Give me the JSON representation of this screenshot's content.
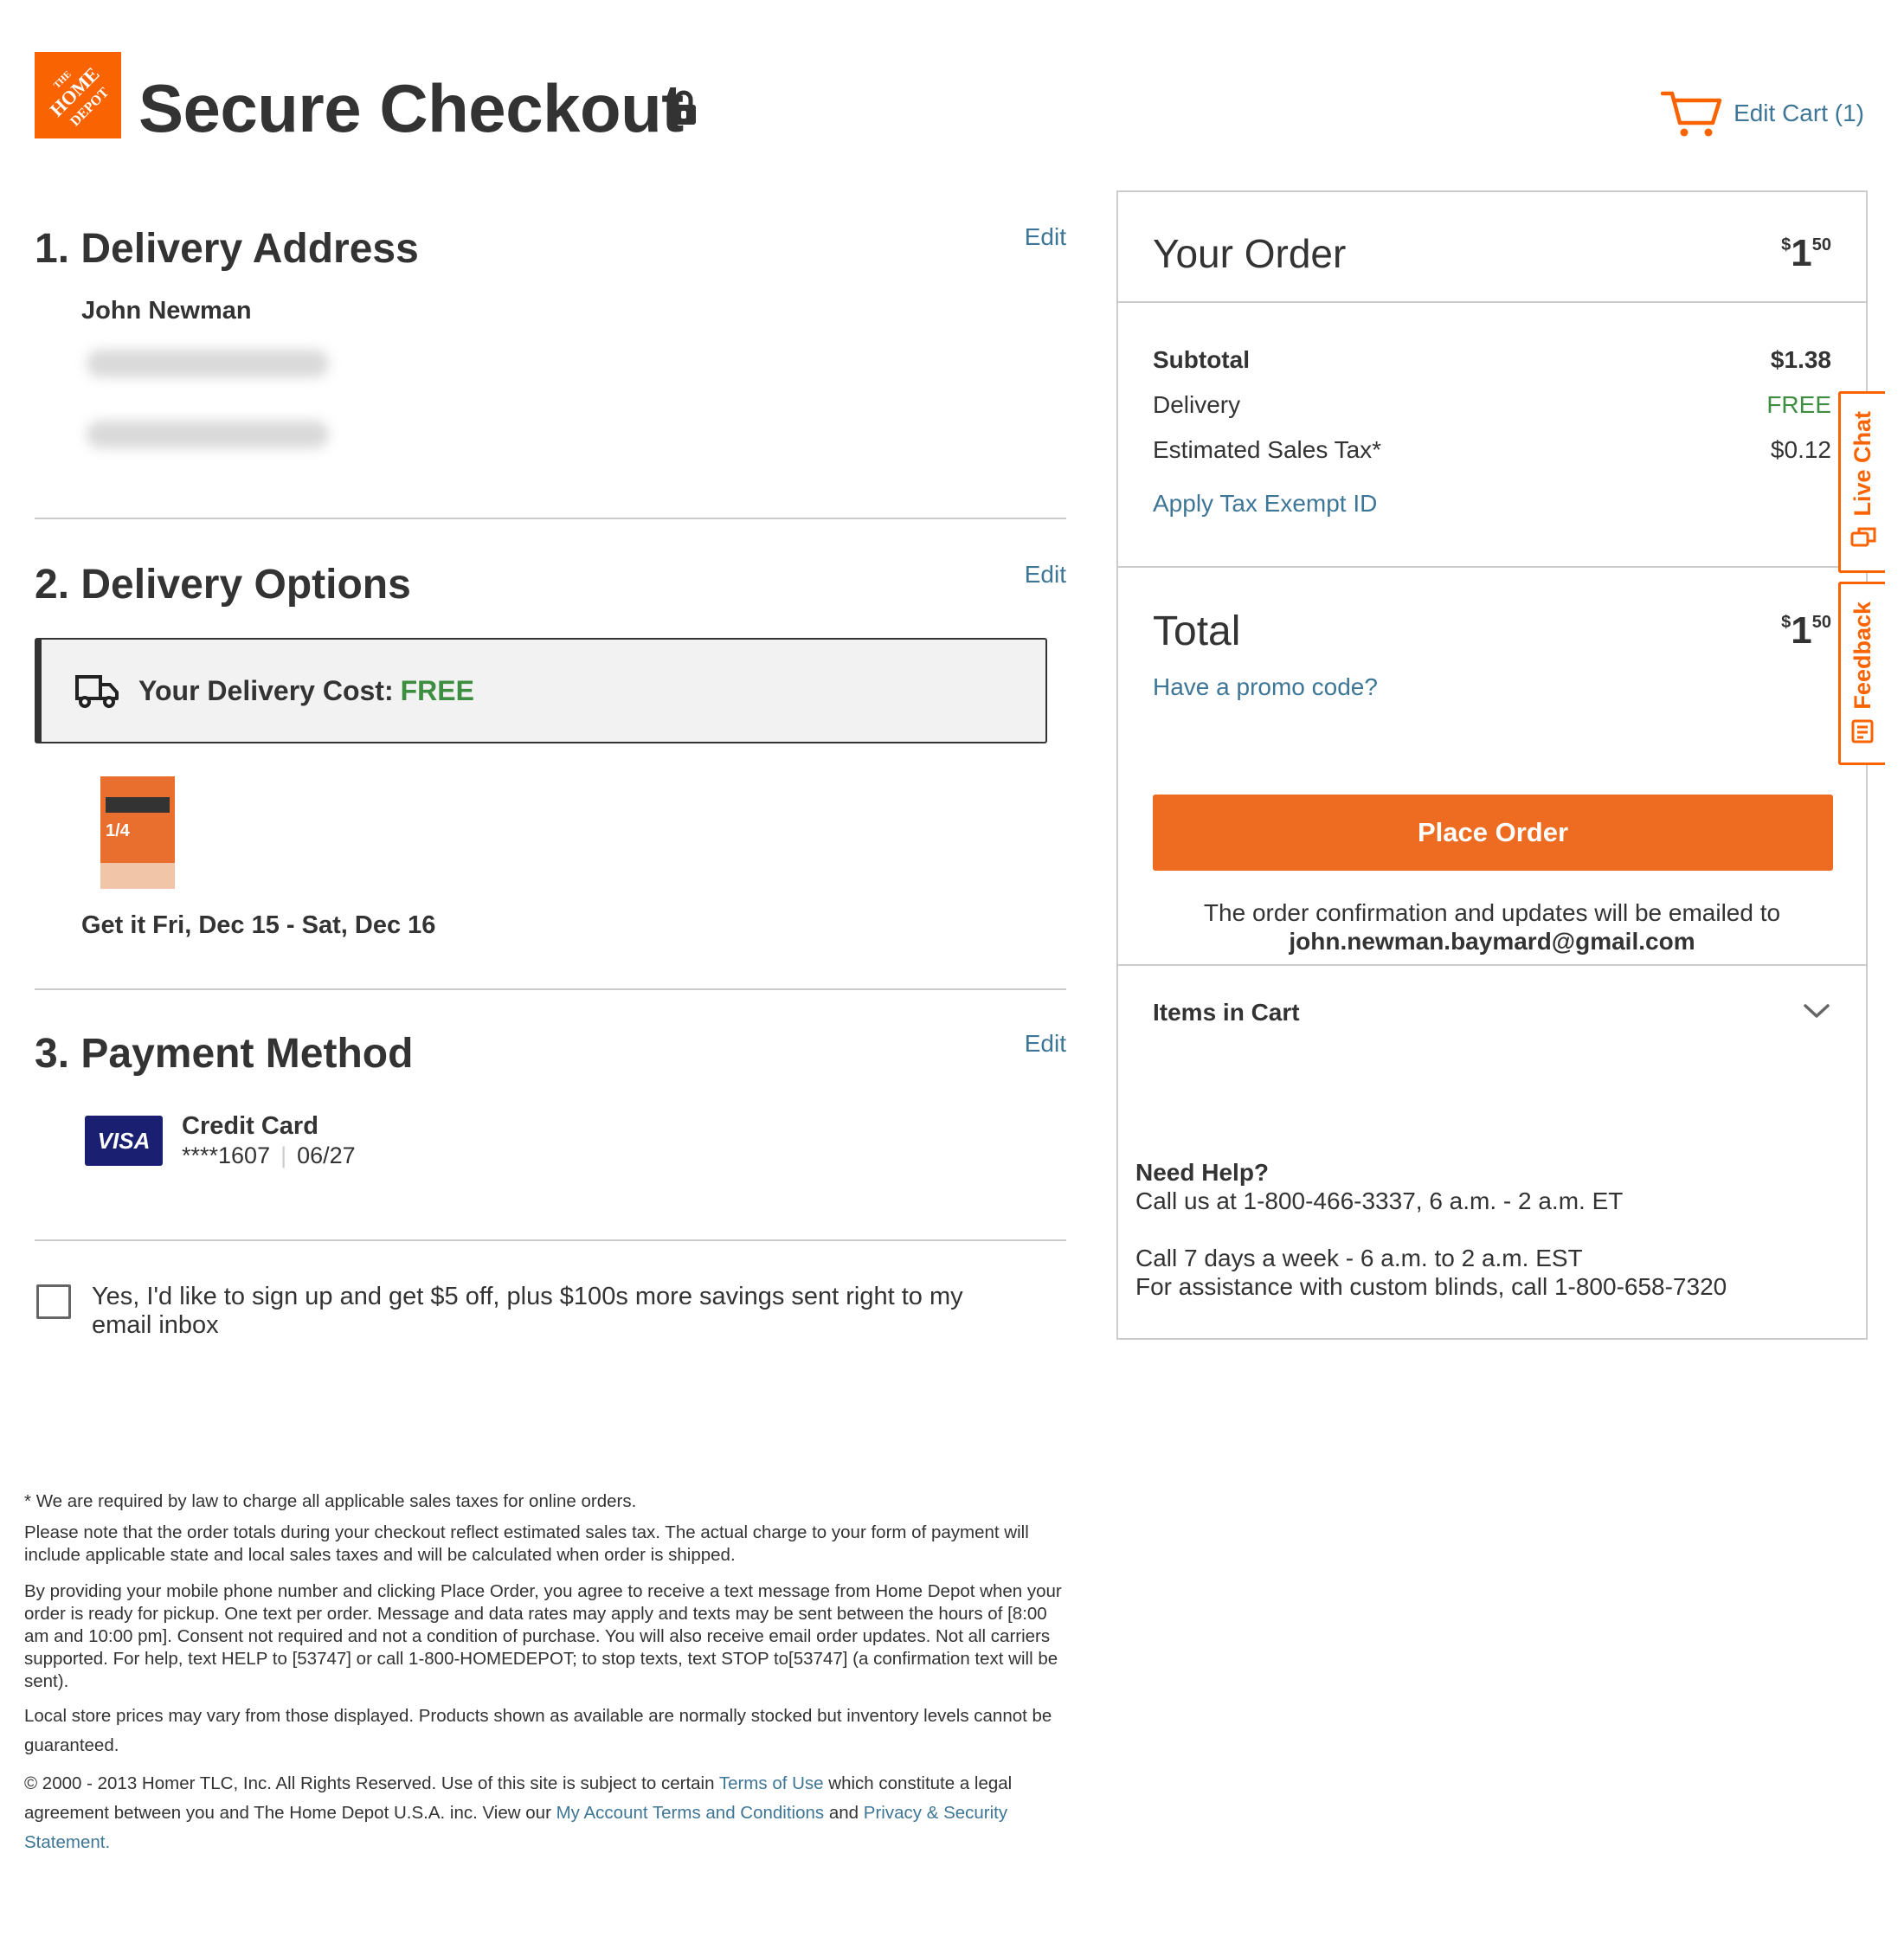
{
  "header": {
    "logo_text": "THE HOME DEPOT",
    "title": "Secure Checkout",
    "lock_icon": "lock-icon",
    "cart_label": "Edit Cart (1)",
    "cart_icon": "cart-icon"
  },
  "colors": {
    "brand_orange": "#f96302",
    "button_orange": "#ed6c22",
    "link_blue": "#3e7697",
    "free_green": "#3e8e41",
    "visa_navy": "#1a1f71"
  },
  "delivery_address": {
    "title": "1. Delivery Address",
    "edit_label": "Edit",
    "name": "John Newman"
  },
  "delivery_options": {
    "title": "2. Delivery Options",
    "edit_label": "Edit",
    "cost_label": "Your Delivery Cost:",
    "cost_value": "FREE",
    "truck_icon": "truck-icon",
    "product_image_text": "1/4",
    "eta": "Get it Fri, Dec 15 - Sat, Dec 16"
  },
  "payment_method": {
    "title": "3. Payment Method",
    "edit_label": "Edit",
    "card_brand": "VISA",
    "card_type": "Credit Card",
    "card_number": "****1607",
    "separator": "|",
    "card_expiry": "06/27"
  },
  "signup": {
    "label": "Yes, I'd like to sign up and get $5 off, plus $100s more savings sent right to my email inbox",
    "checked": false
  },
  "notes": {
    "tax_note_mark": "*",
    "tax_note": "We are required by law to charge all applicable sales taxes for online orders.",
    "estimate_note": "Please note that the order totals during your checkout reflect estimated sales tax. The actual charge to your form of payment will include applicable state and local sales taxes and will be calculated when order is shipped.",
    "sms_note": "By providing your mobile phone number and clicking Place Order, you agree to receive a text message from Home Depot when your order is ready for pickup. One text per order. Message and data rates may apply and texts may be sent between the hours of [8:00 am and 10:00 pm]. Consent not required and not a condition of purchase. You will also receive email order updates. Not all carriers supported. For help, text HELP to [53747] or call 1-800-HOMEDEPOT; to stop texts, text STOP to[53747] (a confirmation text will be sent).",
    "prices_note": "Local store prices may vary from those displayed. Products shown as available are normally stocked but inventory levels cannot be guaranteed.",
    "copyright_pre": "© 2000 - 2013 Homer TLC, Inc. All Rights Reserved. Use of this site is subject to certain",
    "terms_link": "Terms of Use",
    "copyright_mid": "which constitute a legal agreement between you and The Home Depot U.S.A. inc. View our",
    "account_link": "My Account Terms and Conditions",
    "copyright_and": "and",
    "privacy_link": "Privacy & Security Statement."
  },
  "order_panel": {
    "title": "Your Order",
    "price_currency": "$",
    "price_dollars": "1",
    "price_cents": "50",
    "subtotal_label": "Subtotal",
    "subtotal_value": "$1.38",
    "delivery_label": "Delivery",
    "delivery_value": "FREE",
    "tax_label": "Estimated Sales Tax*",
    "tax_value": "$0.12",
    "tax_exempt_link": "Apply Tax Exempt ID",
    "total_label": "Total",
    "promo_link": "Have a promo code?",
    "place_order_label": "Place Order",
    "confirm_text": "The order confirmation and updates will be emailed to",
    "confirm_email": "john.newman.baymard@gmail.com",
    "items_in_cart_label": "Items in Cart",
    "chevron_icon": "chevron-down-icon"
  },
  "help": {
    "title": "Need Help?",
    "line1": "Call us at 1-800-466-3337, 6 a.m. - 2 a.m. ET",
    "line2": "Call 7 days a week - 6 a.m. to 2 a.m. EST",
    "line3": "For assistance with custom blinds, call 1-800-658-7320"
  },
  "side_tabs": {
    "live_chat": "Live Chat",
    "feedback": "Feedback"
  }
}
